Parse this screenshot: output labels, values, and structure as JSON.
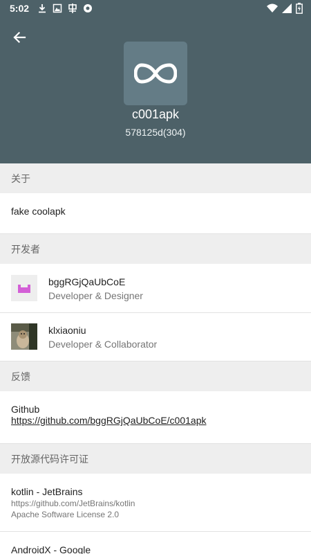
{
  "status_bar": {
    "time": "5:02"
  },
  "header": {
    "app_name": "c001apk",
    "version": "578125d(304)",
    "bg_color": "#4d6168",
    "icon_bg_color": "#647c86"
  },
  "sections": {
    "about": {
      "title": "关于",
      "text": "fake coolapk"
    },
    "developers": {
      "title": "开发者",
      "items": [
        {
          "name": "bggRGjQaUbCoE",
          "role": "Developer & Designer"
        },
        {
          "name": "klxiaoniu",
          "role": "Developer & Collaborator"
        }
      ]
    },
    "feedback": {
      "title": "反馈",
      "label": "Github",
      "url": "https://github.com/bggRGjQaUbCoE/c001apk"
    },
    "licenses": {
      "title": "开放源代码许可证",
      "items": [
        {
          "name": "kotlin - JetBrains",
          "url": "https://github.com/JetBrains/kotlin",
          "license": "Apache Software License 2.0"
        },
        {
          "name": "AndroidX - Google"
        }
      ]
    }
  }
}
